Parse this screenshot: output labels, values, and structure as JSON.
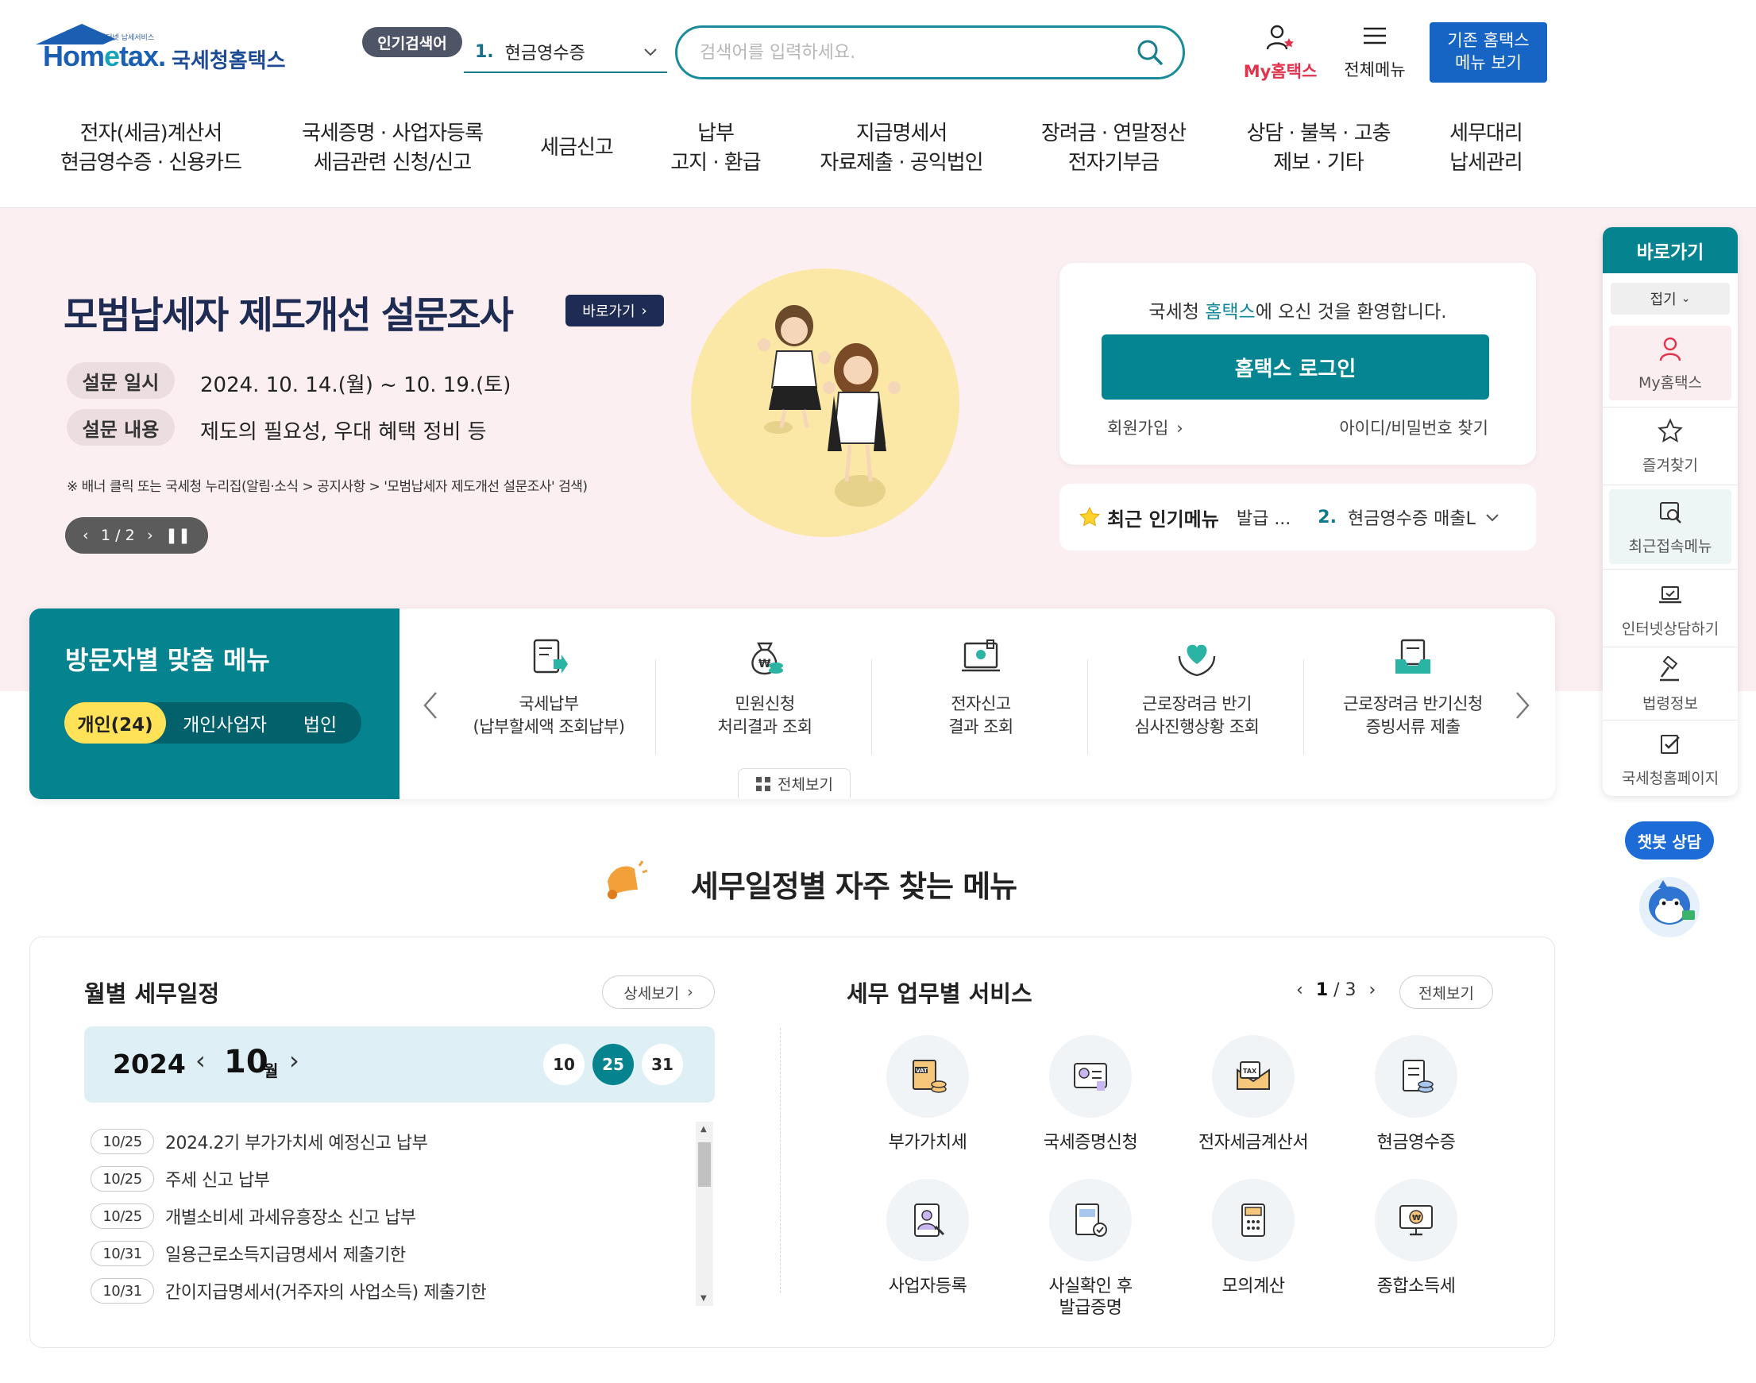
{
  "header": {
    "logo_small": "인터넷 납세서비스",
    "logo_word_a": "Hom",
    "logo_word_e": "e",
    "logo_word_b": "tax.",
    "logo_ko": "국세청홈택스",
    "popular_badge": "인기검색어",
    "popular_num": "1.",
    "popular_value": "현금영수증",
    "search_placeholder": "검색어를 입력하세요.",
    "my_hometax": "My홈택스",
    "all_menu": "전체메뉴",
    "legacy_line1": "기존 홈택스",
    "legacy_line2": "메뉴 보기"
  },
  "gnb": [
    {
      "line1": "전자(세금)계산서",
      "line2": "현금영수증 · 신용카드"
    },
    {
      "line1": "국세증명 · 사업자등록",
      "line2": "세금관련 신청/신고"
    },
    {
      "line1": "세금신고",
      "line2": ""
    },
    {
      "line1": "납부",
      "line2": "고지 · 환급"
    },
    {
      "line1": "지급명세서",
      "line2": "자료제출 · 공익법인"
    },
    {
      "line1": "장려금 · 연말정산",
      "line2": "전자기부금"
    },
    {
      "line1": "상담 · 불복 · 고충",
      "line2": "제보 · 기타"
    },
    {
      "line1": "세무대리",
      "line2": "납세관리"
    }
  ],
  "banner": {
    "title": "모범납세자 제도개선 설문조사",
    "go_label": "바로가기",
    "rows": [
      {
        "label": "설문 일시",
        "value": "2024. 10. 14.(월) ~ 10. 19.(토)"
      },
      {
        "label": "설문 내용",
        "value": "제도의 필요성, 우대 혜택 정비 등"
      }
    ],
    "note": "※ 배너 클릭 또는 국세청 누리집(알림·소식 > 공지사항 > '모범납세자 제도개선 설문조사' 검색)",
    "pager": "1 / 2"
  },
  "login": {
    "welcome_a": "국세청 ",
    "welcome_hl": "홈택스",
    "welcome_b": "에 오신 것을 환영합니다.",
    "button": "홈택스 로그인",
    "signup": "회원가입",
    "find": "아이디/비밀번호 찾기"
  },
  "recent_popular": {
    "title": "최근 인기메뉴",
    "item1": "발급 ...",
    "num2": "2.",
    "item2": "현금영수증 매출L"
  },
  "visitor": {
    "title": "방문자별 맞춤 메뉴",
    "tabs": [
      "개인(24)",
      "개인사업자",
      "법인"
    ],
    "items": [
      {
        "line1": "국세납부",
        "line2": "(납부할세액 조회납부)"
      },
      {
        "line1": "민원신청",
        "line2": "처리결과 조회"
      },
      {
        "line1": "전자신고",
        "line2": "결과 조회"
      },
      {
        "line1": "근로장려금 반기",
        "line2": "심사진행상황 조회"
      },
      {
        "line1": "근로장려금 반기신청",
        "line2": "증빙서류 제출"
      }
    ],
    "view_all": "전체보기"
  },
  "schedule": {
    "heading": "세무일정별 자주 찾는 메뉴",
    "month_title": "월별 세무일정",
    "detail": "상세보기",
    "year": "2024",
    "month": "10",
    "month_unit": "월",
    "days": [
      "10",
      "25",
      "31"
    ],
    "active_day": "25",
    "rows": [
      {
        "date": "10/25",
        "text": "2024.2기 부가가치세 예정신고 납부"
      },
      {
        "date": "10/25",
        "text": "주세 신고 납부"
      },
      {
        "date": "10/25",
        "text": "개별소비세 과세유흥장소 신고 납부"
      },
      {
        "date": "10/31",
        "text": "일용근로소득지급명세서 제출기한"
      },
      {
        "date": "10/31",
        "text": "간이지급명세서(거주자의 사업소득) 제출기한"
      }
    ]
  },
  "services": {
    "title": "세무 업무별 서비스",
    "page_current": "1",
    "page_sep": "/",
    "page_total": "3",
    "view_all": "전체보기",
    "items": [
      {
        "line1": "부가가치세",
        "line2": "",
        "icon": "vat-document-icon"
      },
      {
        "line1": "국세증명신청",
        "line2": "",
        "icon": "certificate-icon"
      },
      {
        "line1": "전자세금계산서",
        "line2": "",
        "icon": "tax-envelope-icon"
      },
      {
        "line1": "현금영수증",
        "line2": "",
        "icon": "receipt-icon"
      },
      {
        "line1": "사업자등록",
        "line2": "",
        "icon": "business-registration-icon"
      },
      {
        "line1": "사실확인 후",
        "line2": "발급증명",
        "icon": "fact-check-icon"
      },
      {
        "line1": "모의계산",
        "line2": "",
        "icon": "calculator-icon"
      },
      {
        "line1": "종합소득세",
        "line2": "",
        "icon": "income-tax-icon"
      }
    ]
  },
  "quick": {
    "title": "바로가기",
    "fold": "접기",
    "items": [
      "My홈택스",
      "즐겨찾기",
      "최근접속메뉴",
      "인터넷상담하기",
      "법령정보",
      "국세청홈페이지"
    ]
  },
  "chatbot": {
    "label": "챗봇 상담"
  },
  "colors": {
    "primary": "#05838f",
    "navy": "#1e2b52",
    "banner_bg": "#fbeff1",
    "accent_yellow": "#ffe257",
    "legacy_blue": "#1664c4",
    "my_red": "#e2334c"
  }
}
